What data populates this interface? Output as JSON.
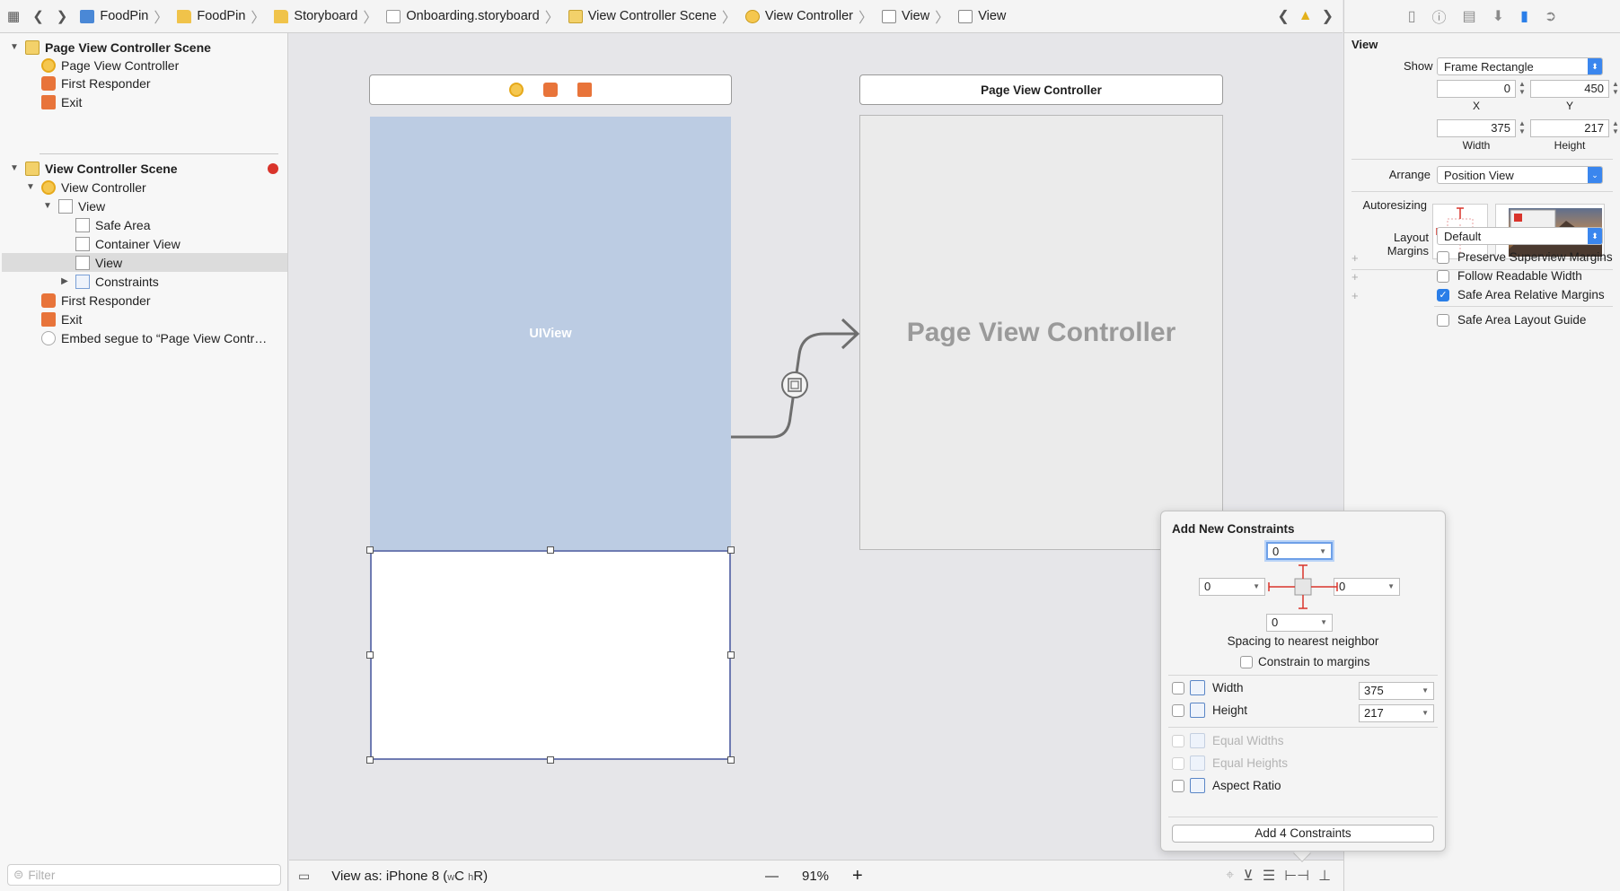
{
  "breadcrumbs": [
    "FoodPin",
    "FoodPin",
    "Storyboard",
    "Onboarding.storyboard",
    "View Controller Scene",
    "View Controller",
    "View",
    "View"
  ],
  "navigator": {
    "items": [
      {
        "label": "Page View Controller Scene",
        "bold": true
      },
      {
        "label": "Page View Controller"
      },
      {
        "label": "First Responder"
      },
      {
        "label": "Exit"
      },
      {
        "label": "View Controller Scene",
        "bold": true
      },
      {
        "label": "View Controller"
      },
      {
        "label": "View"
      },
      {
        "label": "Safe Area"
      },
      {
        "label": "Container View"
      },
      {
        "label": "View",
        "selected": true
      },
      {
        "label": "Constraints"
      },
      {
        "label": "First Responder"
      },
      {
        "label": "Exit"
      },
      {
        "label": "Embed segue to “Page View Contr…"
      }
    ],
    "filter_placeholder": "Filter"
  },
  "canvas": {
    "uiview_label": "UIView",
    "pvc_bar_title": "Page View Controller",
    "pvc_label": "Page View Controller"
  },
  "bottom_bar": {
    "view_as_prefix": "View as: iPhone 8 (",
    "size_w": "w",
    "size_c": "C",
    "size_h": "h",
    "size_r": "R",
    "view_as_suffix": ")",
    "zoom_out": "—",
    "zoom": "91%",
    "zoom_in": "+"
  },
  "inspector": {
    "section_title": "View",
    "show_label": "Show",
    "show_value": "Frame Rectangle",
    "x": "0",
    "y": "450",
    "x_label": "X",
    "y_label": "Y",
    "width": "375",
    "height": "217",
    "width_label": "Width",
    "height_label": "Height",
    "arrange_label": "Arrange",
    "arrange_value": "Position View",
    "autoresizing_label": "Autoresizing",
    "layout_margins_label": "Layout Margins",
    "layout_margins_value": "Default",
    "checkboxes": [
      {
        "label": "Preserve Superview Margins",
        "checked": false
      },
      {
        "label": "Follow Readable Width",
        "checked": false
      },
      {
        "label": "Safe Area Relative Margins",
        "checked": true
      },
      {
        "label": "Safe Area Layout Guide",
        "checked": false
      }
    ],
    "plus": "+"
  },
  "constraints_popover": {
    "title": "Add New Constraints",
    "top": "0",
    "left": "0",
    "right": "0",
    "bottom": "0",
    "spacing_label": "Spacing to nearest neighbor",
    "constrain_margins": "Constrain to margins",
    "width_label": "Width",
    "width_value": "375",
    "height_label": "Height",
    "height_value": "217",
    "equal_widths": "Equal Widths",
    "equal_heights": "Equal Heights",
    "aspect_ratio": "Aspect Ratio",
    "add_button": "Add 4 Constraints"
  },
  "colors": {
    "uiview": "#bccce3",
    "accent": "#2a7ee8",
    "warning": "#e3b11b",
    "error": "#d9342b"
  }
}
